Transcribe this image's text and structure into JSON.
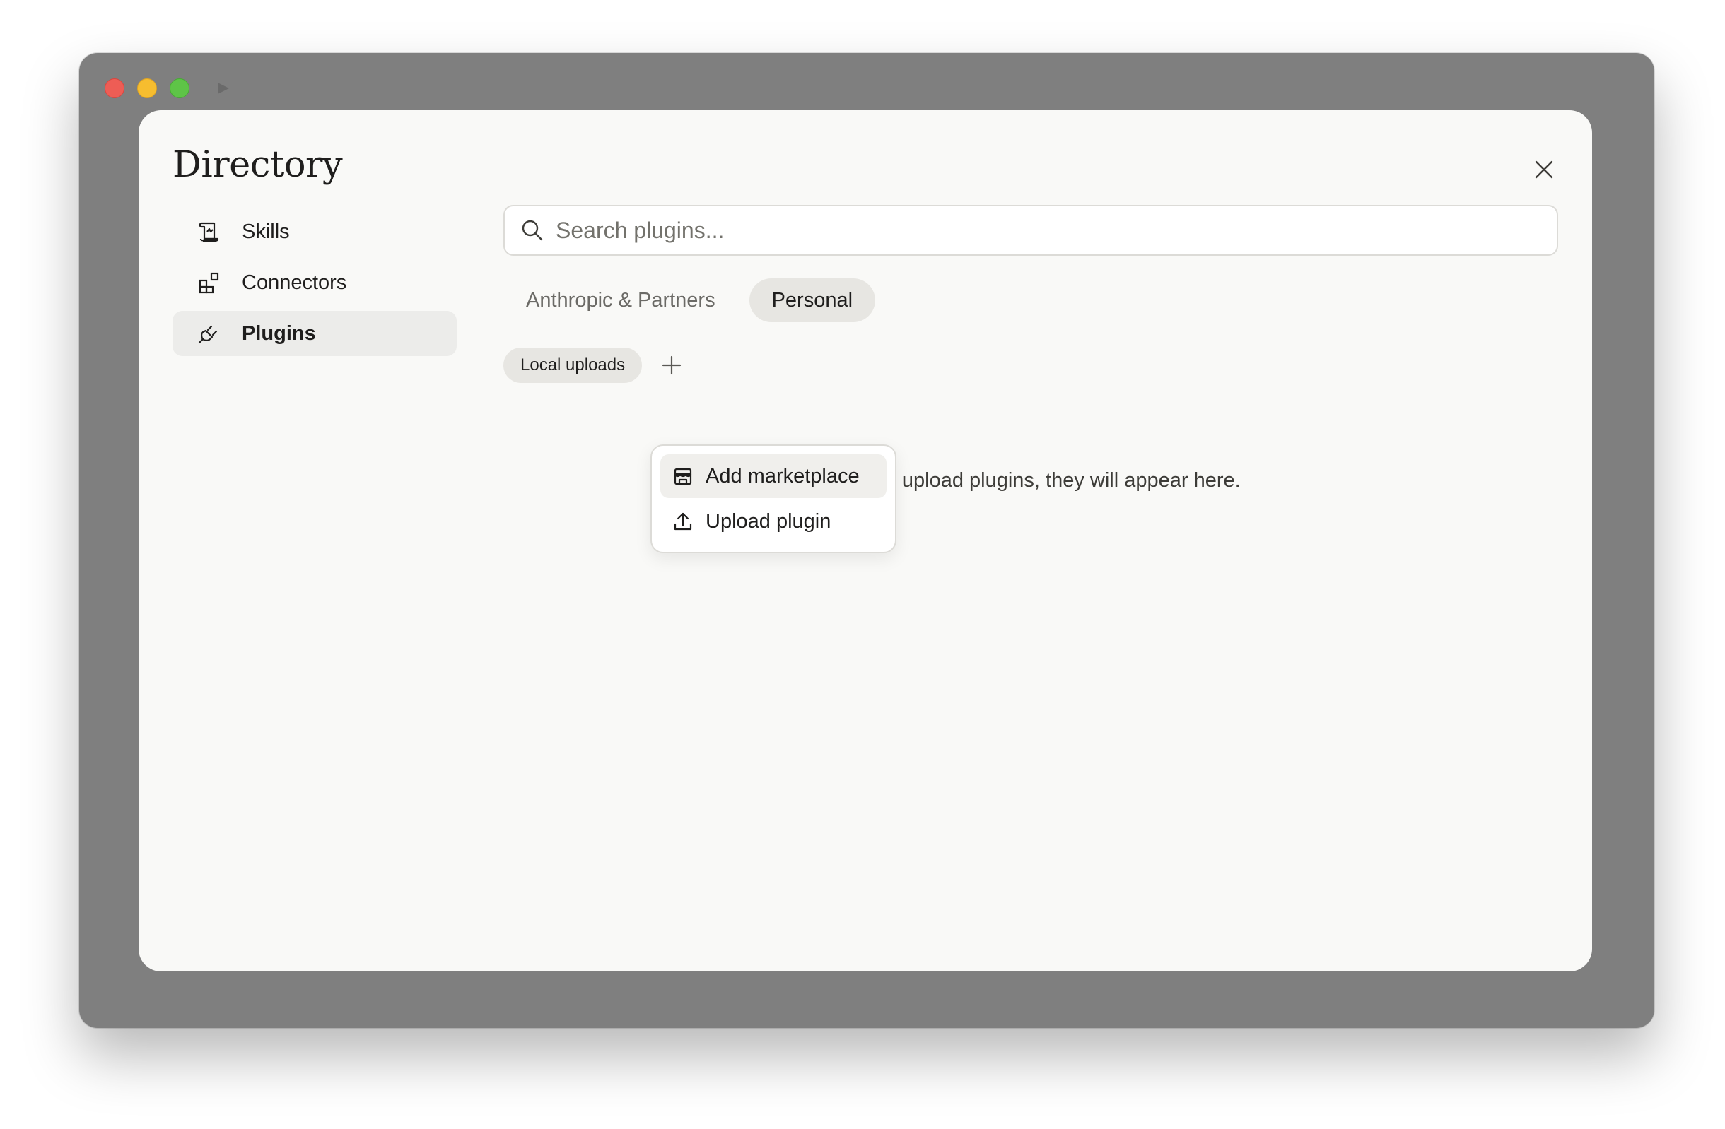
{
  "modal": {
    "title": "Directory"
  },
  "nav": {
    "items": [
      {
        "label": "Skills",
        "icon": "scroll-icon"
      },
      {
        "label": "Connectors",
        "icon": "blocks-icon"
      },
      {
        "label": "Plugins",
        "icon": "plug-icon",
        "active": true
      }
    ]
  },
  "search": {
    "placeholder": "Search plugins...",
    "value": ""
  },
  "tabs": [
    {
      "label": "Anthropic & Partners"
    },
    {
      "label": "Personal",
      "active": true
    }
  ],
  "chips": {
    "local_uploads": "Local uploads"
  },
  "empty_state": {
    "text": "When you upload plugins, they will appear here."
  },
  "dropdown": {
    "items": [
      {
        "label": "Add marketplace",
        "icon": "store-icon"
      },
      {
        "label": "Upload plugin",
        "icon": "upload-icon"
      }
    ]
  },
  "colors": {
    "modal_bg": "#f9f9f7",
    "window_bg": "#7f7f7f",
    "active_bg": "#ececea",
    "text": "#1f1e1d"
  }
}
